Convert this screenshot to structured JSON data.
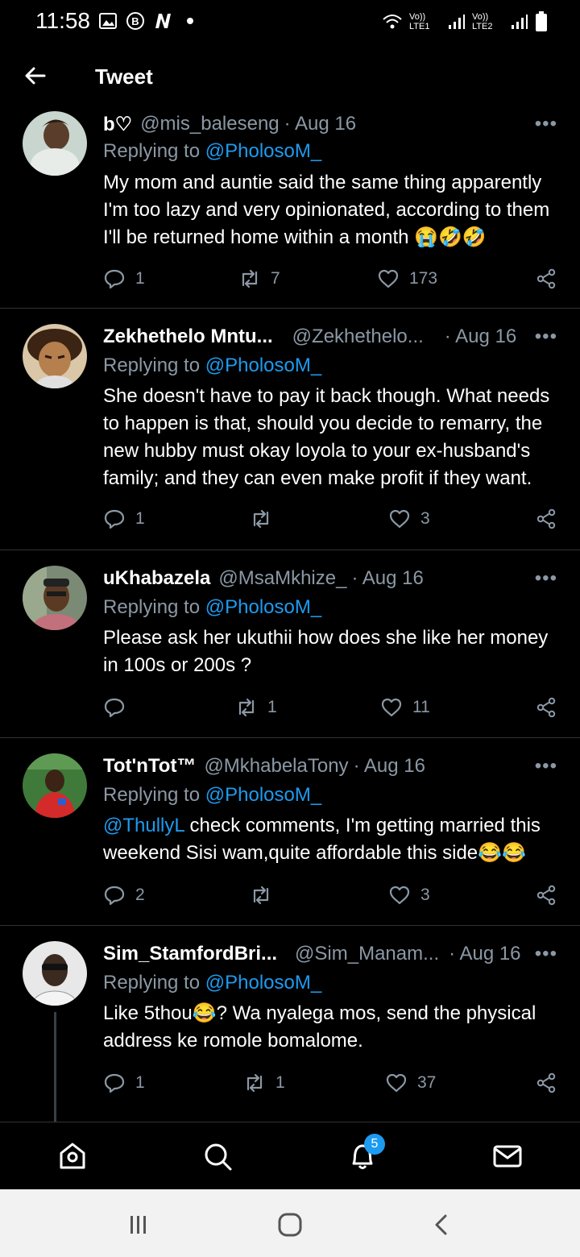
{
  "status_bar": {
    "time": "11:58",
    "left_icons": [
      "image-icon",
      "b-circle-icon",
      "n-icon",
      "dot-icon"
    ],
    "carrier1": "Vo)) LTE1",
    "carrier2": "Vo)) LTE2"
  },
  "header": {
    "title": "Tweet"
  },
  "tweets": [
    {
      "name": "b♡",
      "handle": "@mis_baleseng",
      "date": "· Aug 16",
      "replying_prefix": "Replying to ",
      "replying_to": "@PholosoM_",
      "text_lines": [
        "My mom and auntie said the same thing apparently",
        "I'm too lazy and very opinionated, according to them",
        "I'll be returned home within a month 😭🤣🤣"
      ],
      "replies": "1",
      "retweets": "7",
      "likes": "173"
    },
    {
      "name": "Zekhethelo Mntu...",
      "handle": "@Zekhethelo...",
      "date": "· Aug 16",
      "replying_prefix": "Replying to ",
      "replying_to": "@PholosoM_",
      "text_lines": [
        "She doesn't have to pay it back though. What needs",
        "to happen is that, should you decide to remarry,  the",
        "new hubby must okay loyola to your ex-husband's",
        "family; and they can even make profit if they want."
      ],
      "replies": "1",
      "retweets": "",
      "likes": "3"
    },
    {
      "name": "uKhabazela",
      "handle": "@MsaMkhize_",
      "date": "· Aug 16",
      "replying_prefix": "Replying to ",
      "replying_to": "@PholosoM_",
      "text_lines": [
        "Please ask her ukuthii how does she like her money",
        "in 100s or 200s ?"
      ],
      "replies": "",
      "retweets": "1",
      "likes": "11"
    },
    {
      "name": "Tot'nTot™",
      "handle": "@MkhabelaTony",
      "date": "· Aug 16",
      "replying_prefix": "Replying to ",
      "replying_to": "@PholosoM_",
      "mention": "@ThullyL",
      "text_lines": [
        " check comments, I'm getting married this",
        "weekend Sisi wam,quite affordable this side😂😂"
      ],
      "replies": "2",
      "retweets": "",
      "likes": "3"
    },
    {
      "name": "Sim_StamfordBri...",
      "handle": "@Sim_Manam...",
      "date": "· Aug 16",
      "replying_prefix": "Replying to ",
      "replying_to": "@PholosoM_",
      "text_lines": [
        "Like 5thou😂? Wa nyalega mos, send the physical",
        "address ke romole bomalome."
      ],
      "replies": "1",
      "retweets": "1",
      "likes": "37"
    }
  ],
  "more_label": "•••",
  "bottom_nav": {
    "items": [
      "home-icon",
      "search-icon",
      "notifications-icon",
      "messages-icon"
    ],
    "notification_count": "5"
  },
  "colors": {
    "background": "#000000",
    "secondary_text": "#8b98a5",
    "accent": "#1d9bf0",
    "divider": "#2f3336"
  }
}
